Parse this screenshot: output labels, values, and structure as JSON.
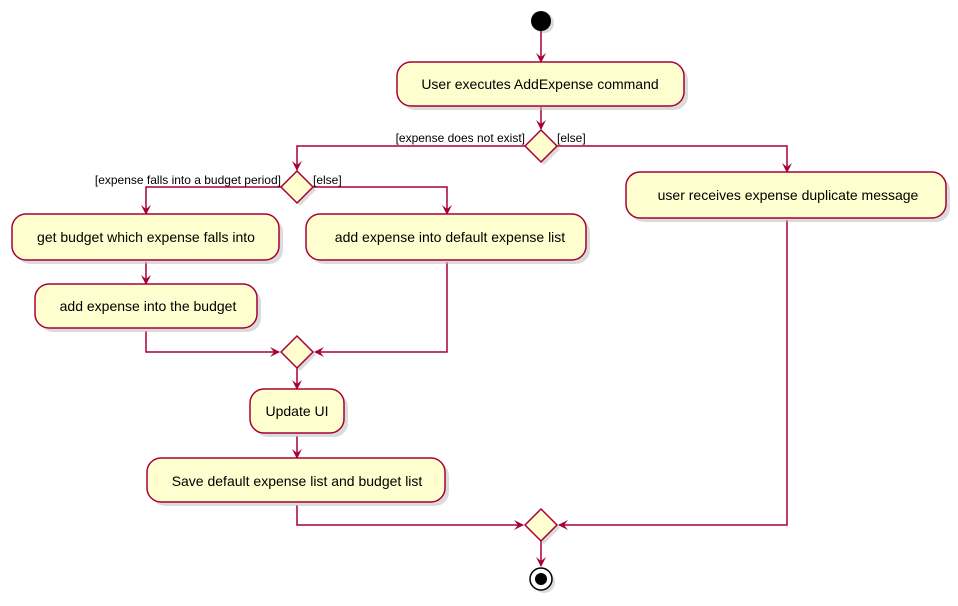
{
  "diagram": {
    "type": "uml-activity",
    "colors": {
      "activity_fill": "#FEFECE",
      "border": "#A80036",
      "arrow": "#A80036",
      "start_end": "#000000"
    },
    "activities": {
      "execute": "User executes AddExpense command",
      "get_budget": "get budget which expense falls into",
      "add_to_budget": "add expense into the budget",
      "add_default": "add expense into default expense list",
      "duplicate": "user receives expense duplicate message",
      "update_ui": "Update UI",
      "save": "Save default expense list and budget list"
    },
    "guards": {
      "not_exist": "[expense does not exist]",
      "else_outer": "[else]",
      "in_budget": "[expense falls into a budget period]",
      "else_inner": "[else]"
    }
  }
}
